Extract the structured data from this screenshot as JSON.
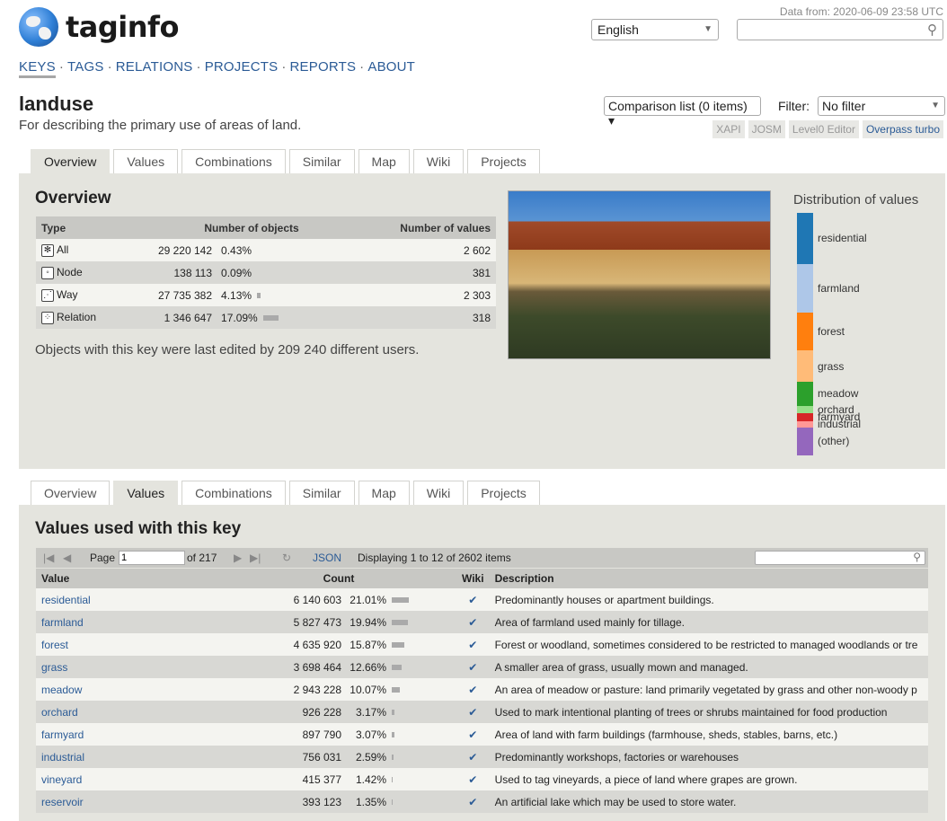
{
  "header": {
    "logo_text": "taginfo",
    "data_from": "Data from: 2020-06-09 23:58 UTC",
    "language": "English",
    "search_placeholder": ""
  },
  "mainnav": [
    "KEYS",
    "TAGS",
    "RELATIONS",
    "PROJECTS",
    "REPORTS",
    "ABOUT"
  ],
  "key": {
    "name": "landuse",
    "description": "For describing the primary use of areas of land."
  },
  "controls": {
    "comparison_list": "Comparison list (0 items)",
    "filter_label": "Filter:",
    "filter_value": "No filter",
    "editors": [
      "XAPI",
      "JOSM",
      "Level0 Editor",
      "Overpass turbo"
    ]
  },
  "tabs": [
    "Overview",
    "Values",
    "Combinations",
    "Similar",
    "Map",
    "Wiki",
    "Projects"
  ],
  "overview": {
    "title": "Overview",
    "headers": [
      "Type",
      "Number of objects",
      "Number of values"
    ],
    "rows": [
      {
        "type": "All",
        "icon": "all-icon",
        "count": "29 220 142",
        "percent": "0.43%",
        "percent_value": 0.43,
        "values": "2 602"
      },
      {
        "type": "Node",
        "icon": "node-icon",
        "count": "138 113",
        "percent": "0.09%",
        "percent_value": 0.09,
        "values": "381"
      },
      {
        "type": "Way",
        "icon": "way-icon",
        "count": "27 735 382",
        "percent": "4.13%",
        "percent_value": 4.13,
        "values": "2 303"
      },
      {
        "type": "Relation",
        "icon": "relation-icon",
        "count": "1 346 647",
        "percent": "17.09%",
        "percent_value": 17.09,
        "values": "318"
      }
    ],
    "edited_text": "Objects with this key were last edited by 209 240 different users."
  },
  "distribution": {
    "title": "Distribution of values",
    "segments": [
      {
        "label": "residential",
        "fraction": 0.2101,
        "color": "#1f77b4"
      },
      {
        "label": "farmland",
        "fraction": 0.1994,
        "color": "#aec7e8"
      },
      {
        "label": "forest",
        "fraction": 0.1587,
        "color": "#ff7f0e"
      },
      {
        "label": "grass",
        "fraction": 0.1266,
        "color": "#ffbb78"
      },
      {
        "label": "meadow",
        "fraction": 0.1007,
        "color": "#2ca02c"
      },
      {
        "label": "orchard",
        "fraction": 0.0317,
        "color": "#98df8a"
      },
      {
        "label": "farmyard",
        "fraction": 0.0307,
        "color": "#d62728"
      },
      {
        "label": "industrial",
        "fraction": 0.0259,
        "color": "#ff9896"
      },
      {
        "label": "(other)",
        "fraction": 0.1162,
        "color": "#9467bd"
      }
    ]
  },
  "values_section": {
    "title": "Values used with this key",
    "pager": {
      "page_label": "Page",
      "page_value": "1",
      "of_pages": "of 217",
      "json": "JSON",
      "displaying": "Displaying 1 to 12 of 2602 items"
    },
    "headers": [
      "Value",
      "Count",
      "Wiki",
      "Description"
    ],
    "rows": [
      {
        "value": "residential",
        "count": "6 140 603",
        "percent": "21.01%",
        "percent_value": 21.01,
        "wiki": "✔",
        "description": "Predominantly houses or apartment buildings."
      },
      {
        "value": "farmland",
        "count": "5 827 473",
        "percent": "19.94%",
        "percent_value": 19.94,
        "wiki": "✔",
        "description": "Area of farmland used mainly for tillage."
      },
      {
        "value": "forest",
        "count": "4 635 920",
        "percent": "15.87%",
        "percent_value": 15.87,
        "wiki": "✔",
        "description": "Forest or woodland, sometimes considered to be restricted to managed woodlands or tre"
      },
      {
        "value": "grass",
        "count": "3 698 464",
        "percent": "12.66%",
        "percent_value": 12.66,
        "wiki": "✔",
        "description": "A smaller area of grass, usually mown and managed."
      },
      {
        "value": "meadow",
        "count": "2 943 228",
        "percent": "10.07%",
        "percent_value": 10.07,
        "wiki": "✔",
        "description": "An area of meadow or pasture: land primarily vegetated by grass and other non-woody p"
      },
      {
        "value": "orchard",
        "count": "926 228",
        "percent": "3.17%",
        "percent_value": 3.17,
        "wiki": "✔",
        "description": "Used to mark intentional planting of trees or shrubs maintained for food production"
      },
      {
        "value": "farmyard",
        "count": "897 790",
        "percent": "3.07%",
        "percent_value": 3.07,
        "wiki": "✔",
        "description": "Area of land with farm buildings (farmhouse, sheds, stables, barns, etc.)"
      },
      {
        "value": "industrial",
        "count": "756 031",
        "percent": "2.59%",
        "percent_value": 2.59,
        "wiki": "✔",
        "description": "Predominantly workshops, factories or warehouses"
      },
      {
        "value": "vineyard",
        "count": "415 377",
        "percent": "1.42%",
        "percent_value": 1.42,
        "wiki": "✔",
        "description": "Used to tag vineyards, a piece of land where grapes are grown."
      },
      {
        "value": "reservoir",
        "count": "393 123",
        "percent": "1.35%",
        "percent_value": 1.35,
        "wiki": "✔",
        "description": "An artificial lake which may be used to store water."
      }
    ]
  }
}
